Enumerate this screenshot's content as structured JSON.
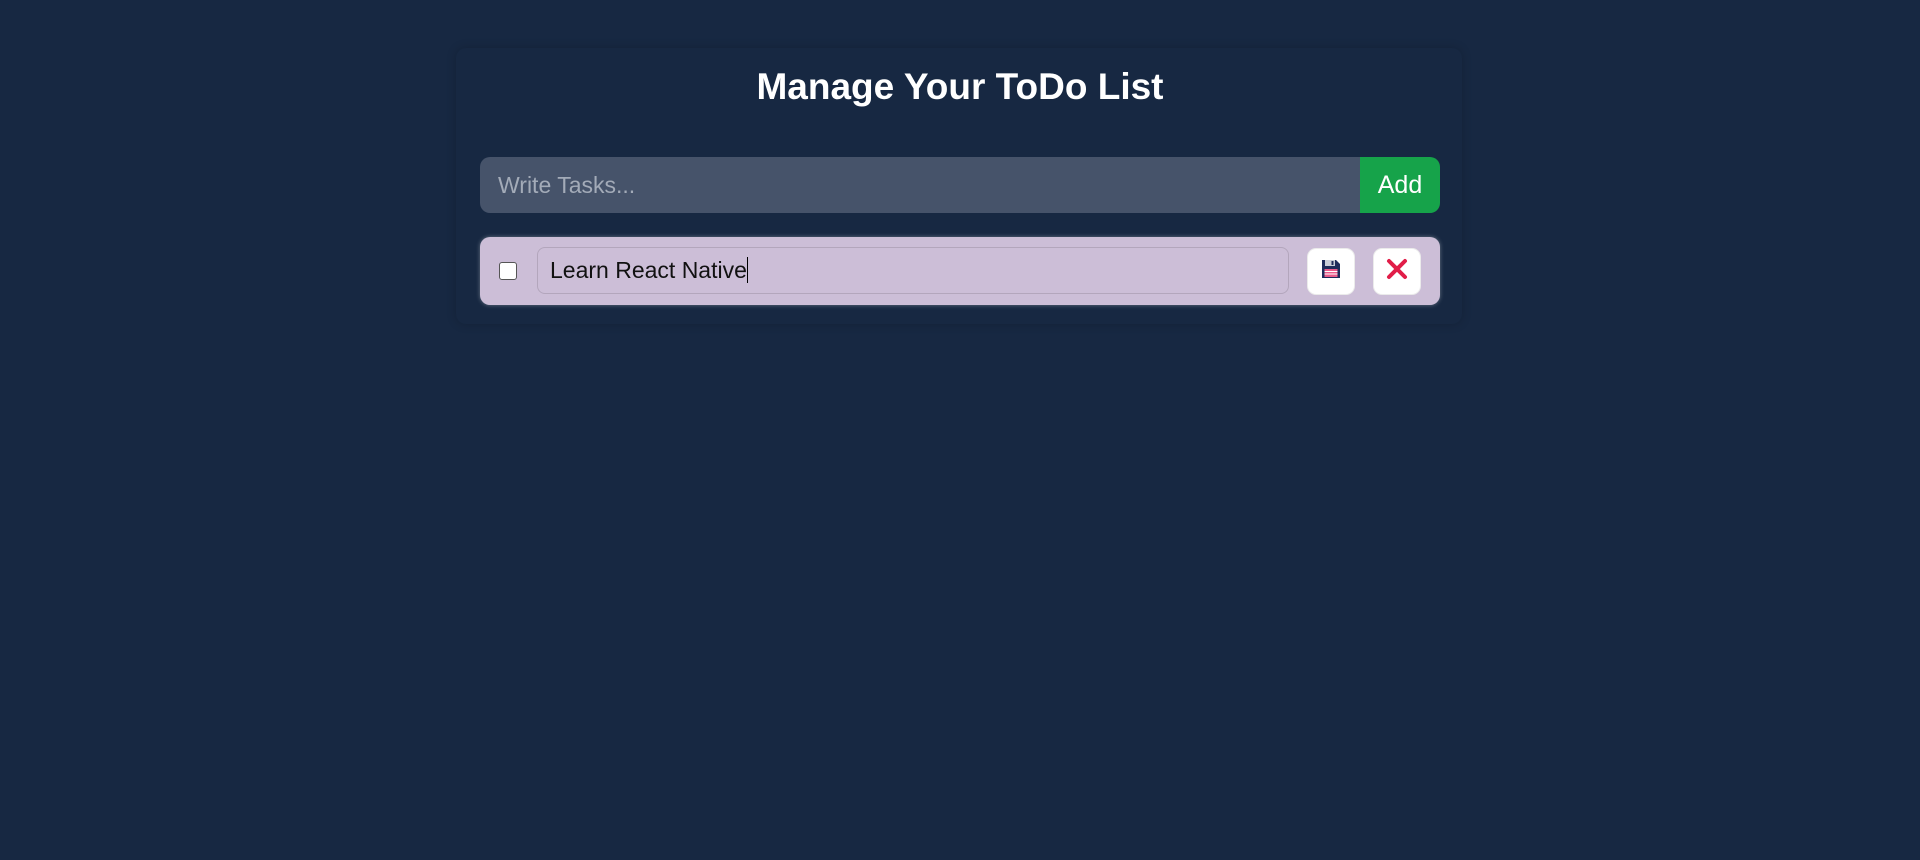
{
  "header": {
    "title": "Manage Your ToDo List"
  },
  "add_form": {
    "placeholder": "Write Tasks...",
    "add_label": "Add"
  },
  "todos": [
    {
      "text": "Learn React Native",
      "completed": false,
      "editing": true,
      "save_icon": "floppy-disk-icon",
      "delete_icon": "close-icon"
    }
  ],
  "colors": {
    "background": "#172842",
    "input_bg": "#46536a",
    "add_button": "#16a34a",
    "todo_bg": "#ccbed7",
    "delete_icon": "#e11d48",
    "save_icon": "#1e2b5a"
  }
}
